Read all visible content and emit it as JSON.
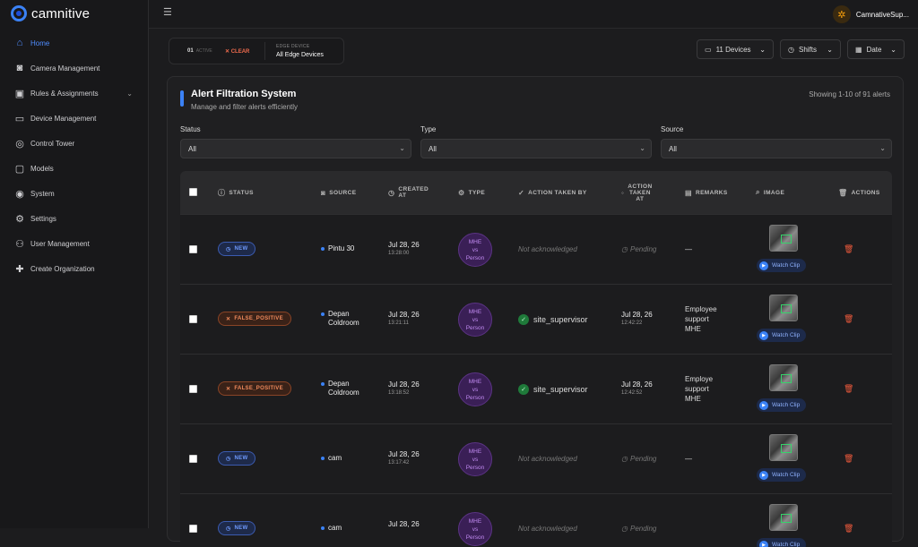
{
  "app": {
    "logo_text": "camnitive",
    "user_name": "CamnativeSup..."
  },
  "sidebar": {
    "items": [
      {
        "label": "Home",
        "icon": "home-icon",
        "active": true
      },
      {
        "label": "Camera Management",
        "icon": "camera-icon"
      },
      {
        "label": "Rules & Assignments",
        "icon": "rules-icon",
        "expandable": true
      },
      {
        "label": "Device Management",
        "icon": "device-icon"
      },
      {
        "label": "Control Tower",
        "icon": "tower-icon"
      },
      {
        "label": "Models",
        "icon": "models-icon"
      },
      {
        "label": "System",
        "icon": "system-icon"
      },
      {
        "label": "Settings",
        "icon": "gear-icon"
      },
      {
        "label": "User Management",
        "icon": "users-icon"
      },
      {
        "label": "Create Organization",
        "icon": "plus-icon"
      }
    ]
  },
  "filters": {
    "active_count": "01",
    "active_label": "ACTIVE",
    "clear_label": "CLEAR",
    "edge_label": "EDGE DEVICE",
    "edge_value": "All Edge Devices",
    "devices_label": "11 Devices",
    "shifts_label": "Shifts",
    "date_label": "Date"
  },
  "panel": {
    "title": "Alert Filtration System",
    "subtitle": "Manage and filter alerts efficiently",
    "showing": "Showing 1-10 of 91 alerts",
    "status_label": "Status",
    "status_value": "All",
    "type_label": "Type",
    "type_value": "All",
    "source_label": "Source",
    "source_value": "All"
  },
  "table": {
    "headers": {
      "status": "STATUS",
      "source": "SOURCE",
      "created_at_1": "CREATED",
      "created_at_2": "AT",
      "type": "TYPE",
      "action_by": "ACTION TAKEN BY",
      "action_at_1": "ACTION",
      "action_at_2": "TAKEN",
      "action_at_3": "AT",
      "remarks": "REMARKS",
      "image": "IMAGE",
      "actions": "ACTIONS"
    },
    "watch_label": "Watch Clip",
    "rows": [
      {
        "status": "NEW",
        "status_kind": "new",
        "source_1": "Pintu 30",
        "source_2": "",
        "created_date": "Jul 28, 26",
        "created_time": "13:28:00",
        "type_1": "MHE",
        "type_2": "vs",
        "type_3": "Person",
        "action_by": "Not acknowledged",
        "acked": false,
        "action_date": "Pending",
        "action_time": "",
        "remark_1": "—",
        "remark_2": "",
        "remark_3": ""
      },
      {
        "status": "FALSE_POSITIVE",
        "status_kind": "fp",
        "source_1": "Depan",
        "source_2": "Coldroom",
        "created_date": "Jul 28, 26",
        "created_time": "13:21:11",
        "type_1": "MHE",
        "type_2": "vs",
        "type_3": "Person",
        "action_by": "site_supervisor",
        "acked": true,
        "action_date": "Jul 28, 26",
        "action_time": "12:42:22",
        "remark_1": "Employee",
        "remark_2": "support",
        "remark_3": "MHE"
      },
      {
        "status": "FALSE_POSITIVE",
        "status_kind": "fp",
        "source_1": "Depan",
        "source_2": "Coldroom",
        "created_date": "Jul 28, 26",
        "created_time": "13:18:52",
        "type_1": "MHE",
        "type_2": "vs",
        "type_3": "Person",
        "action_by": "site_supervisor",
        "acked": true,
        "action_date": "Jul 28, 26",
        "action_time": "12:42:52",
        "remark_1": "Employe",
        "remark_2": "support",
        "remark_3": "MHE"
      },
      {
        "status": "NEW",
        "status_kind": "new",
        "source_1": "cam",
        "source_2": "",
        "created_date": "Jul 28, 26",
        "created_time": "13:17:42",
        "type_1": "MHE",
        "type_2": "vs",
        "type_3": "Person",
        "action_by": "Not acknowledged",
        "acked": false,
        "action_date": "Pending",
        "action_time": "",
        "remark_1": "—",
        "remark_2": "",
        "remark_3": ""
      },
      {
        "status": "NEW",
        "status_kind": "new",
        "source_1": "cam",
        "source_2": "",
        "created_date": "Jul 28, 26",
        "created_time": "",
        "type_1": "MHE",
        "type_2": "vs",
        "type_3": "Person",
        "action_by": "Not acknowledged",
        "acked": false,
        "action_date": "Pending",
        "action_time": "",
        "remark_1": "",
        "remark_2": "",
        "remark_3": ""
      }
    ]
  }
}
